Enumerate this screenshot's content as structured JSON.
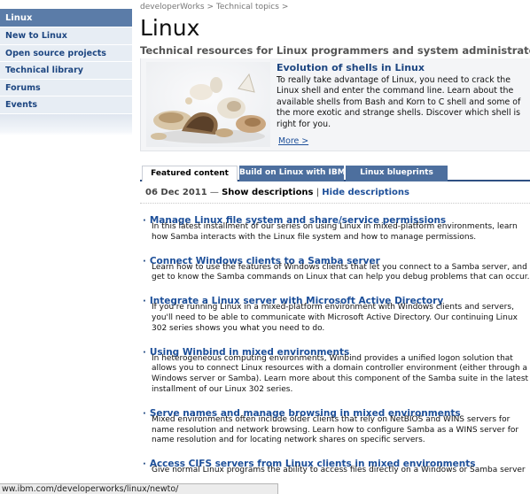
{
  "sidebar": {
    "header": "Linux",
    "items": [
      {
        "label": "New to Linux"
      },
      {
        "label": "Open source projects"
      },
      {
        "label": "Technical library"
      },
      {
        "label": "Forums"
      },
      {
        "label": "Events"
      }
    ]
  },
  "breadcrumb": {
    "items": [
      "developerWorks",
      "Technical topics"
    ],
    "separator": ">"
  },
  "page": {
    "title": "Linux",
    "subtitle": "Technical resources for Linux programmers and system administrators"
  },
  "feature": {
    "title": "Evolution of shells in Linux",
    "body": "To really take advantage of Linux, you need to crack the Linux shell and enter the command line. Learn about the available shells from Bash and Korn to C shell and some of the more exotic and strange shells. Discover which shell is right for you.",
    "more_label": "More >",
    "image_icon": "seashells-image"
  },
  "tabs": [
    {
      "label": "Featured content",
      "active": true
    },
    {
      "label": "Build on Linux with IBM",
      "active": false
    },
    {
      "label": "Linux blueprints",
      "active": false
    }
  ],
  "dateline": {
    "date": "06 Dec 2011",
    "dash": "—",
    "show": "Show descriptions",
    "bar": "|",
    "hide": "Hide descriptions"
  },
  "articles": [
    {
      "title": "Manage Linux file system and share/service permissions",
      "desc": "In this latest installment of our series on using Linux in mixed-platform environments, learn how Samba interacts with the Linux file system and how to manage permissions."
    },
    {
      "title": "Connect Windows clients to a Samba server",
      "desc": "Learn how to use the features of Windows clients that let you connect to a Samba server, and get to know the Samba commands on Linux that can help you debug problems that can occur."
    },
    {
      "title": "Integrate a Linux server with Microsoft Active Directory",
      "desc": "If you're running Linux in a mixed-platform environment with Windows clients and servers, you'll need to be able to communicate with Microsoft Active Directory. Our continuing Linux 302 series shows you what you need to do."
    },
    {
      "title": "Using Winbind in mixed environments",
      "desc": "In heterogeneous computing environments, Winbind provides a unified logon solution that allows you to connect Linux resources with a domain controller environment (either through a Windows server or Samba). Learn more about this component of the Samba suite in the latest installment of our Linux 302 series."
    },
    {
      "title": "Serve names and manage browsing in mixed environments",
      "desc": "Mixed environments often include older clients that rely on NetBIOS and WINS servers for name resolution and network browsing. Learn how to configure Samba as a WINS server for name resolution and for locating network shares on specific servers."
    },
    {
      "title": "Access CIFS servers from Linux clients in mixed environments",
      "desc": "Give normal Linux programs the ability to access files directly on a Windows or Samba server"
    }
  ],
  "statusbar": {
    "url": "ww.ibm.com/developerworks/linux/newto/"
  },
  "colors": {
    "nav_header": "#5b7ca8",
    "nav_item_bg": "#e7edf4",
    "link_blue": "#1d4f99",
    "tab_inactive": "#4d6f9e"
  }
}
